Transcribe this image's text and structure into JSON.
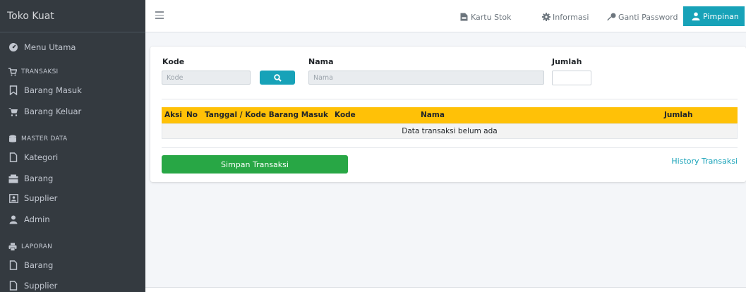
{
  "brand": {
    "title": "Toko Kuat"
  },
  "sidebar": {
    "items": [
      {
        "label": "Menu Utama",
        "icon": "dashboard-icon"
      },
      {
        "label": "TRANSAKSI",
        "icon": "cart-icon",
        "header": true
      },
      {
        "label": "Barang Masuk",
        "icon": "bookmark-icon"
      },
      {
        "label": "Barang Keluar",
        "icon": "cart-icon"
      },
      {
        "label": "MASTER DATA",
        "icon": "database-icon",
        "header": true
      },
      {
        "label": "Kategori",
        "icon": "file-icon"
      },
      {
        "label": "Barang",
        "icon": "box-icon"
      },
      {
        "label": "Supplier",
        "icon": "contact-icon"
      },
      {
        "label": "Admin",
        "icon": "user-icon"
      },
      {
        "label": "LAPORAN",
        "icon": "print-icon",
        "header": true
      },
      {
        "label": "Barang",
        "icon": "file-icon"
      },
      {
        "label": "Supplier",
        "icon": "file-icon"
      }
    ]
  },
  "topbar": {
    "kartu_stok": "Kartu Stok",
    "informasi": "Informasi",
    "ganti_password": "Ganti Password",
    "user": "Pimpinan"
  },
  "form": {
    "kode_label": "Kode",
    "kode_placeholder": "Kode",
    "nama_label": "Nama",
    "nama_placeholder": "Nama",
    "jumlah_label": "Jumlah",
    "jumlah_value": ""
  },
  "table": {
    "headers": [
      "Aksi",
      "No",
      "Tanggal / Kode Barang Masuk",
      "Kode",
      "Nama",
      "Jumlah"
    ],
    "empty_message": "Data transaksi belum ada"
  },
  "actions": {
    "save": "Simpan Transaksi",
    "history": "History Transaksi"
  },
  "colors": {
    "sidebar": "#343a40",
    "accent": "#17a2b8",
    "table_header": "#ffc107",
    "save": "#28a745"
  }
}
